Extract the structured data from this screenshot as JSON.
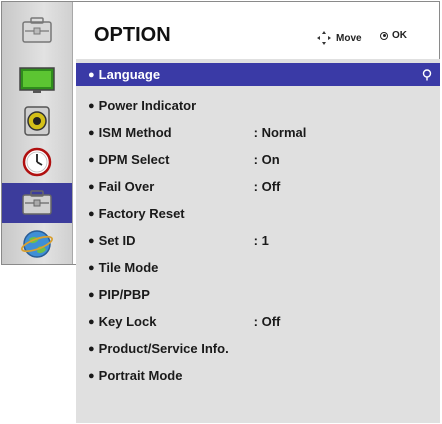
{
  "header": {
    "title": "OPTION",
    "move_hint": "Move",
    "ok_hint": "OK"
  },
  "sidebar": {
    "items": [
      {
        "icon": "picture-icon"
      },
      {
        "icon": "audio-icon"
      },
      {
        "icon": "time-icon"
      },
      {
        "icon": "option-icon",
        "active": true
      },
      {
        "icon": "network-icon"
      }
    ]
  },
  "menu": {
    "bullet": "●",
    "items": [
      {
        "label": "Language",
        "value": "",
        "selected": true
      },
      {
        "label": "Power Indicator",
        "value": ""
      },
      {
        "label": "ISM Method",
        "value": ": Normal"
      },
      {
        "label": "DPM Select",
        "value": ": On"
      },
      {
        "label": "Fail Over",
        "value": ": Off"
      },
      {
        "label": "Factory Reset",
        "value": ""
      },
      {
        "label": "Set ID",
        "value": ": 1"
      },
      {
        "label": "Tile Mode",
        "value": ""
      },
      {
        "label": "PIP/PBP",
        "value": ""
      },
      {
        "label": "Key Lock",
        "value": ": Off"
      },
      {
        "label": "Product/Service Info.",
        "value": ""
      },
      {
        "label": "Portrait Mode",
        "value": ""
      }
    ]
  },
  "colors": {
    "selection": "#3a3aa6",
    "menu_bg": "#e0e0e0",
    "sidebar_active": "#3c3c9c"
  }
}
